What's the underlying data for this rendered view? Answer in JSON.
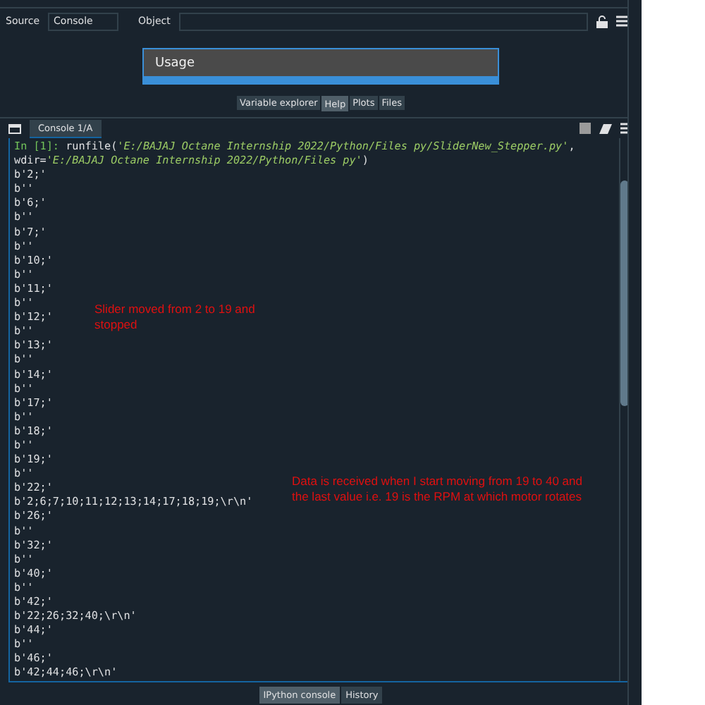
{
  "help_toolbar": {
    "source_label": "Source",
    "source_value": "Console",
    "object_label": "Object"
  },
  "help_panel": {
    "title": "Usage"
  },
  "pane_tabs": [
    {
      "label": "Variable explorer",
      "selected": false
    },
    {
      "label": "Help",
      "selected": true
    },
    {
      "label": "Plots",
      "selected": false
    },
    {
      "label": "Files",
      "selected": false
    }
  ],
  "console_tabs": [
    {
      "label": "Console 1/A",
      "selected": true
    }
  ],
  "console_lines": [
    {
      "parts": [
        {
          "text": "In [1]: ",
          "kind": "prompt"
        },
        {
          "text": "runfile(",
          "kind": "plain"
        },
        {
          "text": "'E:/BAJAJ Octane Internship 2022/Python/Files py/SliderNew_Stepper.py'",
          "kind": "string"
        },
        {
          "text": ",",
          "kind": "plain"
        }
      ]
    },
    {
      "parts": [
        {
          "text": "wdir=",
          "kind": "plain"
        },
        {
          "text": "'E:/BAJAJ Octane Internship 2022/Python/Files py'",
          "kind": "string"
        },
        {
          "text": ")",
          "kind": "plain"
        }
      ]
    },
    {
      "parts": [
        {
          "text": "b'2;'",
          "kind": "plain"
        }
      ]
    },
    {
      "parts": [
        {
          "text": "b''",
          "kind": "plain"
        }
      ]
    },
    {
      "parts": [
        {
          "text": "b'6;'",
          "kind": "plain"
        }
      ]
    },
    {
      "parts": [
        {
          "text": "b''",
          "kind": "plain"
        }
      ]
    },
    {
      "parts": [
        {
          "text": "b'7;'",
          "kind": "plain"
        }
      ]
    },
    {
      "parts": [
        {
          "text": "b''",
          "kind": "plain"
        }
      ]
    },
    {
      "parts": [
        {
          "text": "b'10;'",
          "kind": "plain"
        }
      ]
    },
    {
      "parts": [
        {
          "text": "b''",
          "kind": "plain"
        }
      ]
    },
    {
      "parts": [
        {
          "text": "b'11;'",
          "kind": "plain"
        }
      ]
    },
    {
      "parts": [
        {
          "text": "b''",
          "kind": "plain"
        }
      ]
    },
    {
      "parts": [
        {
          "text": "b'12;'",
          "kind": "plain"
        }
      ]
    },
    {
      "parts": [
        {
          "text": "b''",
          "kind": "plain"
        }
      ]
    },
    {
      "parts": [
        {
          "text": "b'13;'",
          "kind": "plain"
        }
      ]
    },
    {
      "parts": [
        {
          "text": "b''",
          "kind": "plain"
        }
      ]
    },
    {
      "parts": [
        {
          "text": "b'14;'",
          "kind": "plain"
        }
      ]
    },
    {
      "parts": [
        {
          "text": "b''",
          "kind": "plain"
        }
      ]
    },
    {
      "parts": [
        {
          "text": "b'17;'",
          "kind": "plain"
        }
      ]
    },
    {
      "parts": [
        {
          "text": "b''",
          "kind": "plain"
        }
      ]
    },
    {
      "parts": [
        {
          "text": "b'18;'",
          "kind": "plain"
        }
      ]
    },
    {
      "parts": [
        {
          "text": "b''",
          "kind": "plain"
        }
      ]
    },
    {
      "parts": [
        {
          "text": "b'19;'",
          "kind": "plain"
        }
      ]
    },
    {
      "parts": [
        {
          "text": "b''",
          "kind": "plain"
        }
      ]
    },
    {
      "parts": [
        {
          "text": "b'22;'",
          "kind": "plain"
        }
      ]
    },
    {
      "parts": [
        {
          "text": "b'2;6;7;10;11;12;13;14;17;18;19;\\r\\n'",
          "kind": "plain"
        }
      ]
    },
    {
      "parts": [
        {
          "text": "b'26;'",
          "kind": "plain"
        }
      ]
    },
    {
      "parts": [
        {
          "text": "b''",
          "kind": "plain"
        }
      ]
    },
    {
      "parts": [
        {
          "text": "b'32;'",
          "kind": "plain"
        }
      ]
    },
    {
      "parts": [
        {
          "text": "b''",
          "kind": "plain"
        }
      ]
    },
    {
      "parts": [
        {
          "text": "b'40;'",
          "kind": "plain"
        }
      ]
    },
    {
      "parts": [
        {
          "text": "b''",
          "kind": "plain"
        }
      ]
    },
    {
      "parts": [
        {
          "text": "b'42;'",
          "kind": "plain"
        }
      ]
    },
    {
      "parts": [
        {
          "text": "b'22;26;32;40;\\r\\n'",
          "kind": "plain"
        }
      ]
    },
    {
      "parts": [
        {
          "text": "b'44;'",
          "kind": "plain"
        }
      ]
    },
    {
      "parts": [
        {
          "text": "b''",
          "kind": "plain"
        }
      ]
    },
    {
      "parts": [
        {
          "text": "b'46;'",
          "kind": "plain"
        }
      ]
    },
    {
      "parts": [
        {
          "text": "b'42;44;46;\\r\\n'",
          "kind": "plain"
        }
      ]
    }
  ],
  "annotations": [
    {
      "text": "Slider moved  from 2 to 19 and stopped"
    },
    {
      "text": "Data is received when I start moving from 19 to 40 and the last value i.e. 19 is the RPM at which motor rotates"
    }
  ],
  "bottom_tabs": [
    {
      "label": "IPython console",
      "selected": true
    },
    {
      "label": "History",
      "selected": false
    }
  ]
}
